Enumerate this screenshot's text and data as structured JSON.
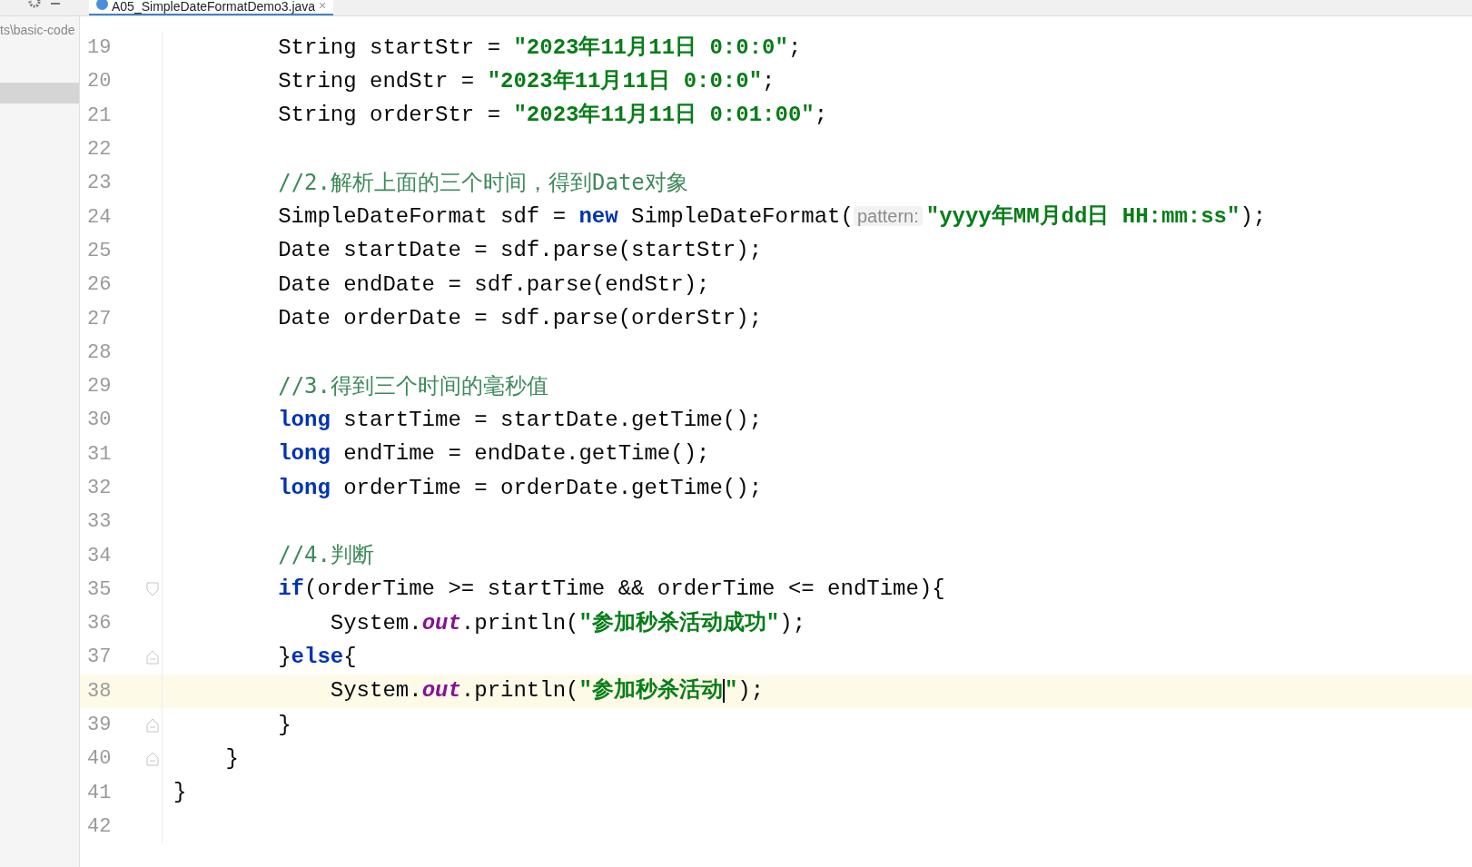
{
  "sidebar": {
    "path": "ts\\basic-code",
    "selected_row": true
  },
  "tab": {
    "title": "A05_SimpleDateFormatDemo3.java",
    "close": "×",
    "selected": true
  },
  "lines": [
    {
      "children": [
        {
          "children": [
            {
              "number": "19",
              "kind": "plain",
              "tokens": [
                {
                  "kind": "plain",
                  "text": "String startStr = "
                },
                {
                  "kind": "string",
                  "text": "\"2023年11月11日 0:0:0\""
                },
                {
                  "kind": "plain",
                  "text": ";"
                }
              ]
            },
            {
              "number": "20",
              "kind": "plain",
              "tokens": [
                {
                  "kind": "plain",
                  "text": "String endStr = "
                },
                {
                  "kind": "string",
                  "text": "\"2023年11月11日 0:0:0\""
                },
                {
                  "kind": "plain",
                  "text": ";"
                }
              ]
            },
            {
              "number": "21",
              "kind": "plain",
              "tokens": [
                {
                  "kind": "plain",
                  "text": "String orderStr = "
                },
                {
                  "kind": "string",
                  "text": "\"2023年11月11日 0:01:00\""
                },
                {
                  "kind": "plain",
                  "text": ";"
                }
              ]
            },
            {
              "number": "22",
              "kind": "plain"
            },
            {
              "number": "23",
              "kind": "plain",
              "tokens": [
                {
                  "kind": "comment",
                  "text": "//2.解析上面的三个时间，得到Date对象"
                }
              ]
            },
            {
              "number": "24",
              "kind": "plain",
              "tokens": [
                {
                  "kind": "plain",
                  "text": "SimpleDateFormat sdf = "
                },
                {
                  "kind": "keyword",
                  "text": "new"
                },
                {
                  "kind": "plain",
                  "text": " SimpleDateFormat("
                },
                {
                  "kind": "hint",
                  "text": "pattern:"
                },
                {
                  "kind": "string",
                  "text": "\"yyyy年MM月dd日 HH:mm:ss\""
                },
                {
                  "kind": "plain",
                  "text": ");"
                }
              ]
            },
            {
              "number": "25",
              "kind": "plain",
              "tokens": [
                {
                  "kind": "plain",
                  "text": "Date startDate = sdf.parse(startStr);"
                }
              ]
            },
            {
              "number": "26",
              "kind": "plain",
              "tokens": [
                {
                  "kind": "plain",
                  "text": "Date endDate = sdf.parse(endStr);"
                }
              ]
            },
            {
              "number": "27",
              "kind": "plain",
              "tokens": [
                {
                  "kind": "plain",
                  "text": "Date orderDate = sdf.parse(orderStr);"
                }
              ]
            },
            {
              "number": "28",
              "kind": "plain"
            },
            {
              "number": "29",
              "kind": "plain",
              "tokens": [
                {
                  "kind": "comment",
                  "text": "//3.得到三个时间的毫秒值"
                }
              ]
            },
            {
              "number": "30",
              "kind": "plain",
              "tokens": [
                {
                  "kind": "keyword",
                  "text": "long"
                },
                {
                  "kind": "plain",
                  "text": " startTime = startDate.getTime();"
                }
              ]
            },
            {
              "number": "31",
              "kind": "plain",
              "tokens": [
                {
                  "kind": "keyword",
                  "text": "long"
                },
                {
                  "kind": "plain",
                  "text": " endTime = endDate.getTime();"
                }
              ]
            },
            {
              "number": "32",
              "kind": "plain",
              "tokens": [
                {
                  "kind": "keyword",
                  "text": "long"
                },
                {
                  "kind": "plain",
                  "text": " orderTime = orderDate.getTime();"
                }
              ]
            },
            {
              "number": "33",
              "kind": "plain"
            },
            {
              "number": "34",
              "kind": "plain",
              "tokens": [
                {
                  "kind": "comment",
                  "text": "//4.判断"
                }
              ]
            },
            {
              "number": "35",
              "kind": "fold_start",
              "tokens": [
                {
                  "kind": "keyword",
                  "text": "if"
                },
                {
                  "kind": "plain",
                  "text": "(orderTime >= startTime && orderTime <= endTime){"
                }
              ],
              "children": [
                {
                  "number": "36",
                  "kind": "plain",
                  "tokens": [
                    {
                      "kind": "plain",
                      "text": "System."
                    },
                    {
                      "kind": "static",
                      "text": "out"
                    },
                    {
                      "kind": "plain",
                      "text": ".println("
                    },
                    {
                      "kind": "string",
                      "text": "\"参加秒杀活动成功\""
                    },
                    {
                      "kind": "plain",
                      "text": ");"
                    }
                  ]
                }
              ]
            },
            {
              "number": "37",
              "kind": "fold_end",
              "tokens": [
                {
                  "kind": "plain",
                  "text": "}"
                },
                {
                  "kind": "keyword",
                  "text": "else"
                },
                {
                  "kind": "plain",
                  "text": "{"
                }
              ],
              "children": [
                {
                  "number": "38",
                  "kind": "plain",
                  "current": true,
                  "tokens": [
                    {
                      "kind": "plain",
                      "text": "System."
                    },
                    {
                      "kind": "static",
                      "text": "out"
                    },
                    {
                      "kind": "plain",
                      "text": ".println("
                    },
                    {
                      "kind": "string",
                      "text": "\"参加秒杀活动"
                    },
                    {
                      "kind": "caret"
                    },
                    {
                      "kind": "string",
                      "text": "\""
                    },
                    {
                      "kind": "plain",
                      "text": ");"
                    }
                  ]
                }
              ]
            },
            {
              "number": "39",
              "kind": "fold_end",
              "tokens": [
                {
                  "kind": "plain",
                  "text": "}"
                }
              ]
            }
          ]
        },
        {
          "number": "40",
          "kind": "fold_end",
          "tokens": [
            {
              "kind": "plain",
              "text": "}"
            }
          ]
        }
      ]
    },
    {
      "number": "41",
      "kind": "plain",
      "tokens": [
        {
          "kind": "plain",
          "text": "}"
        }
      ]
    },
    {
      "number": "42",
      "kind": "plain"
    }
  ]
}
